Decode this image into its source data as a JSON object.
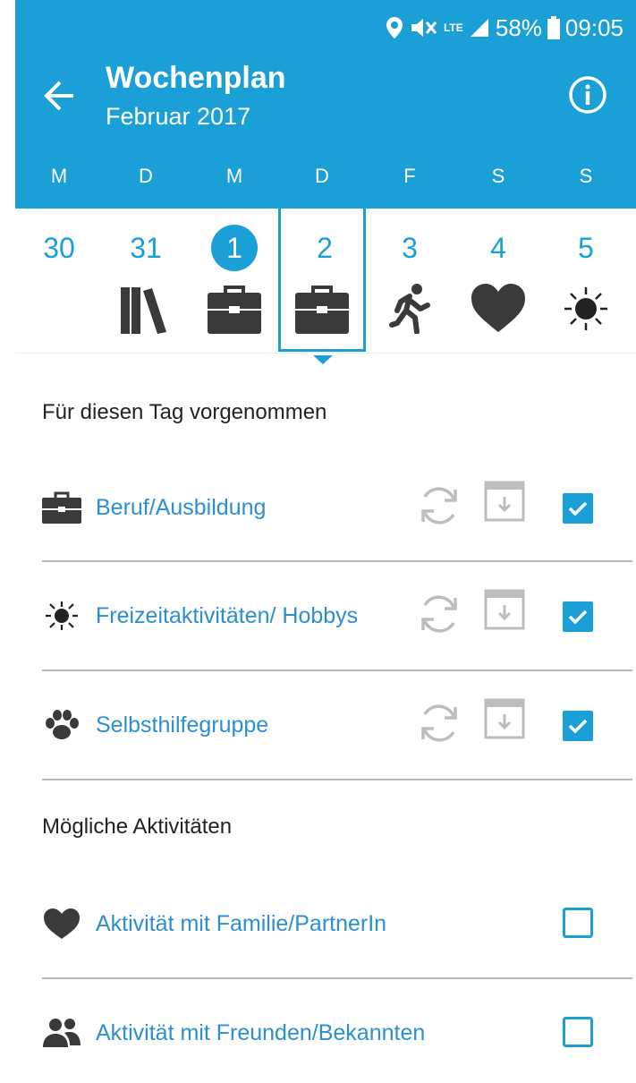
{
  "status": {
    "battery_percent": "58%",
    "time": "09:05",
    "network": "LTE"
  },
  "header": {
    "title": "Wochenplan",
    "subtitle": "Februar 2017"
  },
  "weekdays": [
    "M",
    "D",
    "M",
    "D",
    "F",
    "S",
    "S"
  ],
  "days": [
    {
      "num": "30",
      "icon": "books-icon"
    },
    {
      "num": "31",
      "icon": "books-icon"
    },
    {
      "num": "1",
      "icon": "briefcase-icon",
      "today": true
    },
    {
      "num": "2",
      "icon": "briefcase-icon",
      "selected": true
    },
    {
      "num": "3",
      "icon": "running-icon"
    },
    {
      "num": "4",
      "icon": "heart-icon"
    },
    {
      "num": "5",
      "icon": "sun-icon"
    }
  ],
  "planned": {
    "heading": "Für diesen Tag vorgenommen",
    "items": [
      {
        "label": "Beruf/Ausbildung",
        "icon": "briefcase-icon",
        "checked": true
      },
      {
        "label": "Freizeitaktivitäten/ Hobbys",
        "icon": "sun-icon",
        "checked": true
      },
      {
        "label": "Selbsthilfegruppe",
        "icon": "paw-icon",
        "checked": true
      }
    ]
  },
  "possible": {
    "heading": "Mögliche Aktivitäten",
    "items": [
      {
        "label": "Aktivität mit Familie/PartnerIn",
        "icon": "heart-icon",
        "checked": false
      },
      {
        "label": "Aktivität mit Freunden/Bekannten",
        "icon": "people-icon",
        "checked": false
      }
    ]
  },
  "colors": {
    "primary": "#1a9fd6",
    "link": "#2b8fd0",
    "icon_dark": "#3a3a3a",
    "icon_grey": "#bdbdbd"
  }
}
